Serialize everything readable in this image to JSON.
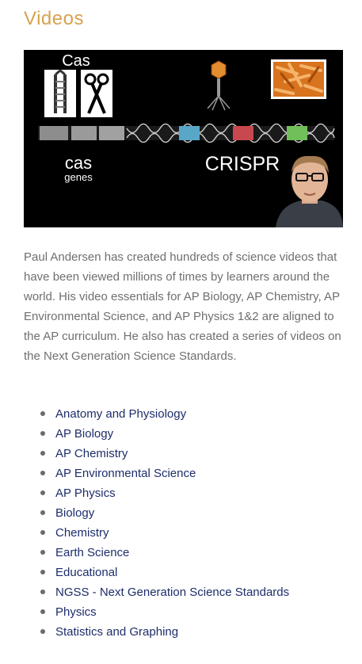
{
  "page": {
    "heading": "Videos",
    "description": "Paul Andersen has created hundreds of science videos that have been viewed millions of times by learners around the world.   His video essentials for AP Biology, AP Chemistry, AP Environmental Science, and AP Physics 1&2 are aligned to the AP curriculum.  He also has created a series of videos on the Next Generation Science Standards."
  },
  "video": {
    "cas_label": "Cas",
    "cas_lower": "cas",
    "genes_label": "genes",
    "crispr_label": "CRISPR"
  },
  "links": [
    "Anatomy and Physiology",
    "AP Biology",
    "AP Chemistry",
    "AP Environmental Science",
    "AP Physics",
    "Biology",
    "Chemistry",
    "Earth Science",
    "Educational",
    "NGSS - Next Generation Science Standards",
    "Physics",
    "Statistics and Graphing"
  ],
  "colors": {
    "heading": "#d9a24e",
    "body_text": "#6f6f6f",
    "link": "#1d2d6b"
  }
}
